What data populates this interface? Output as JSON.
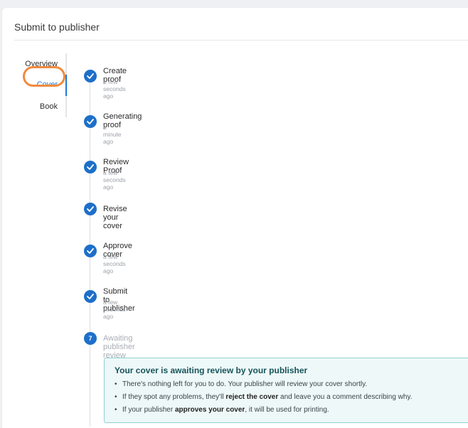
{
  "page": {
    "title": "Submit to publisher"
  },
  "nav": {
    "items": [
      {
        "label": "Overview"
      },
      {
        "label": "Cover"
      },
      {
        "label": "Book"
      }
    ],
    "active": "Cover"
  },
  "steps": [
    {
      "title": "Create proof",
      "time": "a few seconds ago",
      "status": "done"
    },
    {
      "title": "Generating proof",
      "time": "a minute ago",
      "status": "done"
    },
    {
      "title": "Review Proof",
      "time": "a few seconds ago",
      "status": "done"
    },
    {
      "title": "Revise your cover",
      "time": "",
      "status": "done"
    },
    {
      "title": "Approve cover",
      "time": "a few seconds ago",
      "status": "done"
    },
    {
      "title": "Submit to publisher",
      "time": "a few seconds ago",
      "status": "done"
    },
    {
      "title": "Awaiting publisher review",
      "time": "",
      "status": "pending",
      "number": "7"
    }
  ],
  "info": {
    "title": "Your cover is awaiting review by your publisher",
    "bullets": [
      {
        "pre": "There's nothing left for you to do. Your publisher will review your cover shortly.",
        "bold": "",
        "post": ""
      },
      {
        "pre": "If they spot any problems, they'll ",
        "bold": "reject the cover",
        "post": " and leave you a comment describing why."
      },
      {
        "pre": "If your publisher ",
        "bold": "approves your cover",
        "post": ", it will be used for printing."
      }
    ],
    "bullet_char": "•"
  },
  "colors": {
    "accent": "#1d6fc9",
    "nav_active": "#1d7ad8",
    "highlight": "#f08a3e",
    "info_bg": "#eef8f8",
    "info_border": "#8fd3d3"
  },
  "icons": {
    "done": "check-circle-icon",
    "pending": "step-number-icon"
  }
}
